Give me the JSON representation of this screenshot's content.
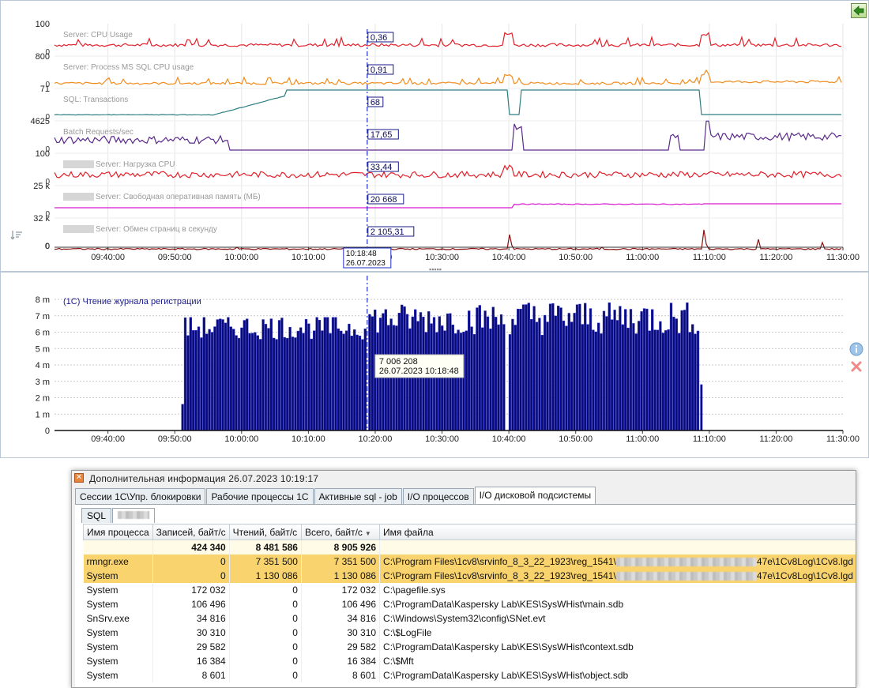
{
  "top_chart": {
    "left_axis_labels": [
      "100",
      "800",
      "71",
      "4625",
      "100",
      "25 k",
      "32 k",
      "0"
    ],
    "lane_zero_labels": [
      "0",
      "0",
      "0",
      "0",
      "0",
      "0",
      "0"
    ],
    "series": [
      {
        "name": "Server: CPU Usage",
        "value": "0,36",
        "color": "#e0202a"
      },
      {
        "name": "Server: Process MS SQL CPU usage",
        "value": "0,91",
        "color": "#f08c1e"
      },
      {
        "name": "SQL: Transactions",
        "value": "68",
        "color": "#2e7f84"
      },
      {
        "name": "Batch Requests/sec",
        "value": "17,65",
        "color": "#5a2a8a"
      },
      {
        "name": "Server: Нагрузка CPU",
        "value": "33,44",
        "color": "#e0202a"
      },
      {
        "name": "Server: Свободная оперативная память (МБ)",
        "value": "20 668",
        "color": "#d81bd0"
      },
      {
        "name": "Server: Обмен страниц в секунду",
        "value": "2 105,31",
        "color": "#8a1010"
      }
    ],
    "x_ticks": [
      "09:40:00",
      "09:50:00",
      "10:00:00",
      "10:10:00",
      "10:20:00",
      "10:30:00",
      "10:40:00",
      "10:50:00",
      "11:00:00",
      "11:10:00",
      "11:20:00",
      "11:30:00"
    ],
    "cursor_time": "10:18:48",
    "cursor_date": "26.07.2023"
  },
  "bottom_chart": {
    "title": "(1С) Чтение журнала регистрации",
    "y_ticks": [
      "8 m",
      "7 m",
      "6 m",
      "5 m",
      "4 m",
      "3 m",
      "2 m",
      "1 m",
      "0"
    ],
    "x_ticks": [
      "09:40:00",
      "09:50:00",
      "10:00:00",
      "10:10:00",
      "10:20:00",
      "10:30:00",
      "10:40:00",
      "10:50:00",
      "11:00:00",
      "11:10:00",
      "11:20:00",
      "11:30:00"
    ],
    "tooltip_value": "7 006 208",
    "tooltip_time": "26.07.2023 10:18:48"
  },
  "chart_data": {
    "type": "bar",
    "title": "(1С) Чтение журнала регистрации",
    "x_range": [
      "09:32:00",
      "11:30:00"
    ],
    "ylim": [
      0,
      8000000
    ],
    "bar_groups": [
      {
        "from": "09:51:00",
        "to": "10:18:30",
        "mean": 6300000,
        "min": 5400000,
        "max": 6900000
      },
      {
        "from": "10:19:00",
        "to": "10:39:30",
        "mean": 6800000,
        "min": 5800000,
        "max": 7700000
      },
      {
        "from": "10:40:00",
        "to": "11:08:30",
        "mean": 6900000,
        "min": 5600000,
        "max": 7800000
      }
    ],
    "highlight": {
      "x": "10:18:48",
      "y": 7006208
    }
  },
  "info_window": {
    "title": "Дополнительная  информация  26.07.2023 10:19:17",
    "tabs": [
      "Сессии 1С\\Упр. блокировки",
      "Рабочие процессы 1С",
      "Активные sql - job",
      "I/O процессов",
      "I/O дисковой подсистемы"
    ],
    "active_tab": 4,
    "subtabs": [
      "SQL"
    ],
    "columns": [
      "Имя процесса",
      "Записей, байт/с",
      "Чтений, байт/с",
      "Всего, байт/с",
      "Имя файла"
    ],
    "totals": {
      "writes": "424 340",
      "reads": "8 481 586",
      "total": "8 905 926"
    },
    "rows": [
      {
        "process": "rmngr.exe",
        "writes": "0",
        "reads": "7 351 500",
        "total": "7 351 500",
        "file_a": "C:\\Program Files\\1cv8\\srvinfo_8_3_22_1923\\reg_1541\\",
        "file_b": "47e\\1Cv8Log\\1Cv8.lgd",
        "highlight": true
      },
      {
        "process": "System",
        "writes": "0",
        "reads": "1 130 086",
        "total": "1 130 086",
        "file_a": "C:\\Program Files\\1cv8\\srvinfo_8_3_22_1923\\reg_1541\\",
        "file_b": "47e\\1Cv8Log\\1Cv8.lgd",
        "highlight": true
      },
      {
        "process": "System",
        "writes": "172 032",
        "reads": "0",
        "total": "172 032",
        "file_a": "C:\\pagefile.sys",
        "file_b": ""
      },
      {
        "process": "System",
        "writes": "106 496",
        "reads": "0",
        "total": "106 496",
        "file_a": "C:\\ProgramData\\Kaspersky Lab\\KES\\SysWHist\\main.sdb",
        "file_b": ""
      },
      {
        "process": "SnSrv.exe",
        "writes": "34 816",
        "reads": "0",
        "total": "34 816",
        "file_a": "C:\\Windows\\System32\\config\\SNet.evt",
        "file_b": ""
      },
      {
        "process": "System",
        "writes": "30 310",
        "reads": "0",
        "total": "30 310",
        "file_a": "C:\\$LogFile",
        "file_b": ""
      },
      {
        "process": "System",
        "writes": "29 582",
        "reads": "0",
        "total": "29 582",
        "file_a": "C:\\ProgramData\\Kaspersky Lab\\KES\\SysWHist\\context.sdb",
        "file_b": ""
      },
      {
        "process": "System",
        "writes": "16 384",
        "reads": "0",
        "total": "16 384",
        "file_a": "C:\\$Mft",
        "file_b": ""
      },
      {
        "process": "System",
        "writes": "8 601",
        "reads": "0",
        "total": "8 601",
        "file_a": "C:\\ProgramData\\Kaspersky Lab\\KES\\SysWHist\\object.sdb",
        "file_b": ""
      }
    ]
  }
}
